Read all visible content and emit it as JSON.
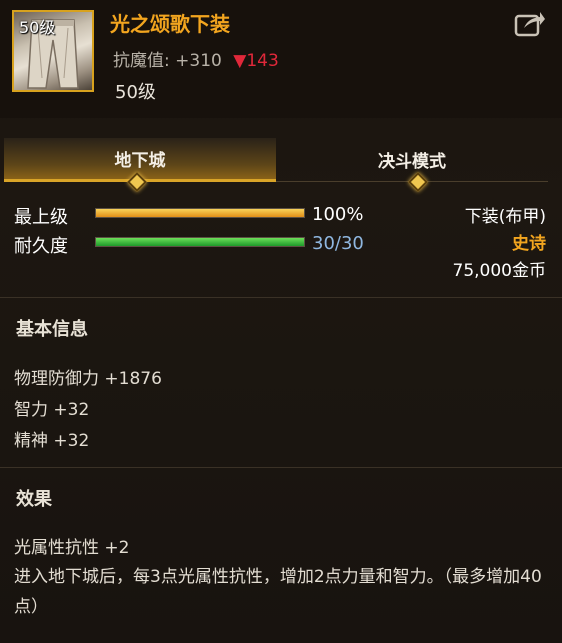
{
  "item": {
    "level_badge": "50级",
    "name": "光之颂歌下装",
    "resist_label": "抗魔值:",
    "resist_value": "+310",
    "resist_diff": "▼143",
    "level": "50级"
  },
  "tabs": [
    {
      "label": "地下城",
      "active": true
    },
    {
      "label": "决斗模式",
      "active": false
    }
  ],
  "stats": {
    "max_level": {
      "label": "最上级",
      "value": "100%",
      "fraction": 1.0
    },
    "durability": {
      "label": "耐久度",
      "value": "30/30",
      "fraction": 1.0
    }
  },
  "summary": {
    "slot": "下装(布甲)",
    "rarity": "史诗",
    "price": "75,000金币"
  },
  "basic_info": {
    "title": "基本信息",
    "lines": [
      "物理防御力 +1876",
      "智力 +32",
      "精神 +32"
    ]
  },
  "effect": {
    "title": "效果",
    "line1": "光属性抗性 +2",
    "desc": "进入地下城后，每3点光属性抗性，增加2点力量和智力。（最多增加40点）"
  },
  "colors": {
    "accent": "#f2a51f",
    "rarity": "#f2a51f",
    "down": "#e0283a",
    "durability_text": "#8fb7e0"
  },
  "icons": {
    "share": "share-arrow-icon",
    "tab_marker": "diamond-icon"
  }
}
